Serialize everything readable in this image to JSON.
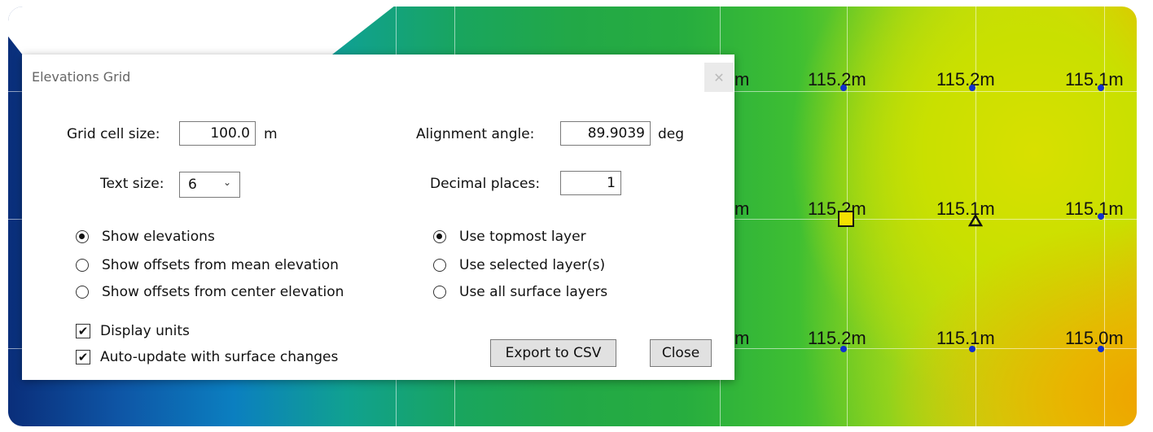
{
  "map": {
    "labels": [
      {
        "text": "m",
        "row": 0,
        "col": 0
      },
      {
        "text": "115.2m",
        "row": 0,
        "col": 1
      },
      {
        "text": "115.2m",
        "row": 0,
        "col": 2
      },
      {
        "text": "115.1m",
        "row": 0,
        "col": 3
      },
      {
        "text": "m",
        "row": 1,
        "col": 0
      },
      {
        "text": "115.2m",
        "row": 1,
        "col": 1
      },
      {
        "text": "115.1m",
        "row": 1,
        "col": 2
      },
      {
        "text": "115.1m",
        "row": 1,
        "col": 3
      },
      {
        "text": "m",
        "row": 2,
        "col": 0
      },
      {
        "text": "115.2m",
        "row": 2,
        "col": 1
      },
      {
        "text": "115.1m",
        "row": 2,
        "col": 2
      },
      {
        "text": "115.0m",
        "row": 2,
        "col": 3
      }
    ],
    "colors": {
      "deep_blue": "#0a2e7a",
      "green": "#22a847",
      "yellow": "#d8e000",
      "orange": "#f0a000",
      "marker_fill": "#f5e100",
      "dot": "#1030d0"
    }
  },
  "dialog": {
    "title": "Elevations Grid",
    "close_icon": "close-icon",
    "grid_cell_size": {
      "label": "Grid cell size:",
      "value": "100.0",
      "unit": "m"
    },
    "alignment_angle": {
      "label": "Alignment angle:",
      "value": "89.9039",
      "unit": "deg"
    },
    "text_size": {
      "label": "Text size:",
      "value": "6"
    },
    "decimal_places": {
      "label": "Decimal places:",
      "value": "1"
    },
    "display_mode": {
      "options": [
        "Show elevations",
        "Show offsets from mean elevation",
        "Show offsets from center elevation"
      ],
      "selected": 0
    },
    "layer_mode": {
      "options": [
        "Use topmost layer",
        "Use selected layer(s)",
        "Use all surface layers"
      ],
      "selected": 0
    },
    "checkboxes": [
      {
        "label": "Display units",
        "checked": true
      },
      {
        "label": "Auto-update with surface changes",
        "checked": true
      }
    ],
    "export_label": "Export to CSV",
    "close_label": "Close"
  }
}
